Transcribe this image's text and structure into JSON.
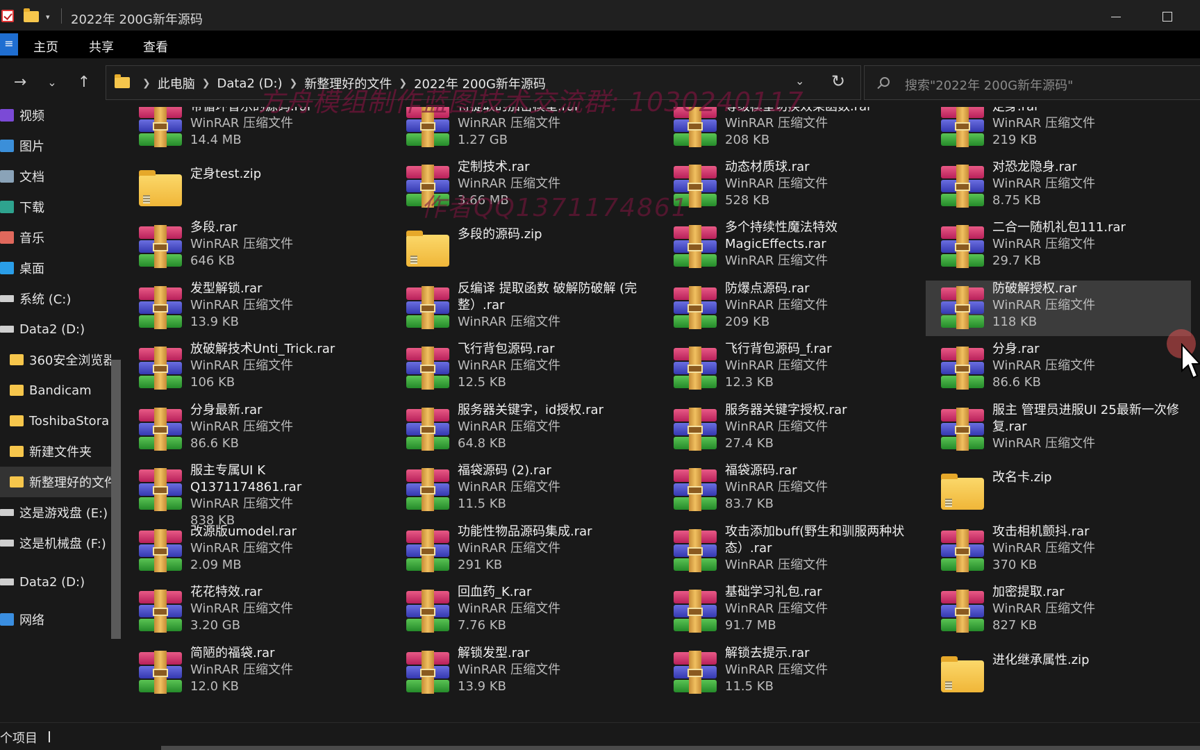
{
  "window": {
    "title": "2022年 200G新年源码",
    "title_dropdown": "▾"
  },
  "ribbon": {
    "file_label": "≡",
    "tabs": [
      "主页",
      "共享",
      "查看"
    ]
  },
  "address": {
    "breadcrumbs": [
      "此电脑",
      "Data2 (D:)",
      "新整理好的文件",
      "2022年 200G新年源码"
    ],
    "search_placeholder": "搜索\"2022年 200G新年源码\""
  },
  "sidebar": {
    "items": [
      {
        "label": "视频",
        "icon": "video-icon"
      },
      {
        "label": "图片",
        "icon": "picture-icon"
      },
      {
        "label": "文档",
        "icon": "document-icon"
      },
      {
        "label": "下载",
        "icon": "download-icon"
      },
      {
        "label": "音乐",
        "icon": "music-icon"
      },
      {
        "label": "桌面",
        "icon": "desktop-icon"
      },
      {
        "label": "系统 (C:)",
        "icon": "drive-icon"
      },
      {
        "label": "Data2 (D:)",
        "icon": "drive-icon"
      },
      {
        "label": "360安全浏览器",
        "icon": "folder-icon"
      },
      {
        "label": "Bandicam",
        "icon": "folder-icon"
      },
      {
        "label": "ToshibaStora",
        "icon": "folder-icon"
      },
      {
        "label": "新建文件夹",
        "icon": "folder-icon"
      },
      {
        "label": "新整理好的文件",
        "icon": "folder-icon"
      },
      {
        "label": "这是游戏盘 (E:)",
        "icon": "drive-icon"
      },
      {
        "label": "这是机械盘 (F:)",
        "icon": "drive-icon"
      },
      {
        "label": "Data2 (D:)",
        "icon": "drive-icon"
      },
      {
        "label": "网络",
        "icon": "network-icon"
      }
    ]
  },
  "files": [
    {
      "name": "带循环音乐的源码.rar",
      "type": "WinRAR 压缩文件",
      "size": "14.4 MB",
      "kind": "rar"
    },
    {
      "name": "待提取的加密模型.rar",
      "type": "WinRAR 压缩文件",
      "size": "1.27 GB",
      "kind": "rar"
    },
    {
      "name": "等级模型切换效果函数.rar",
      "type": "WinRAR 压缩文件",
      "size": "208 KB",
      "kind": "rar"
    },
    {
      "name": "定身.rar",
      "type": "WinRAR 压缩文件",
      "size": "219 KB",
      "kind": "rar"
    },
    {
      "name": "定身test.zip",
      "type": "",
      "size": "",
      "kind": "zip"
    },
    {
      "name": "定制技术.rar",
      "type": "WinRAR 压缩文件",
      "size": "3.66 MB",
      "kind": "rar"
    },
    {
      "name": "动态材质球.rar",
      "type": "WinRAR 压缩文件",
      "size": "528 KB",
      "kind": "rar"
    },
    {
      "name": "对恐龙隐身.rar",
      "type": "WinRAR 压缩文件",
      "size": "8.75 KB",
      "kind": "rar"
    },
    {
      "name": "多段.rar",
      "type": "WinRAR 压缩文件",
      "size": "646 KB",
      "kind": "rar"
    },
    {
      "name": "多段的源码.zip",
      "type": "",
      "size": "",
      "kind": "zip"
    },
    {
      "name": "多个持续性魔法特效 MagicEffects.rar",
      "type": "WinRAR 压缩文件",
      "size": "",
      "kind": "rar"
    },
    {
      "name": "二合一随机礼包111.rar",
      "type": "WinRAR 压缩文件",
      "size": "29.7 KB",
      "kind": "rar"
    },
    {
      "name": "发型解锁.rar",
      "type": "WinRAR 压缩文件",
      "size": "13.9 KB",
      "kind": "rar"
    },
    {
      "name": "反编译 提取函数 破解防破解 (完整）.rar",
      "type": "WinRAR 压缩文件",
      "size": "",
      "kind": "rar"
    },
    {
      "name": "防爆点源码.rar",
      "type": "WinRAR 压缩文件",
      "size": "209 KB",
      "kind": "rar"
    },
    {
      "name": "防破解授权.rar",
      "type": "WinRAR 压缩文件",
      "size": "118 KB",
      "kind": "rar"
    },
    {
      "name": "放破解技术Unti_Trick.rar",
      "type": "WinRAR 压缩文件",
      "size": "106 KB",
      "kind": "rar"
    },
    {
      "name": "飞行背包源码.rar",
      "type": "WinRAR 压缩文件",
      "size": "12.5 KB",
      "kind": "rar"
    },
    {
      "name": "飞行背包源码_f.rar",
      "type": "WinRAR 压缩文件",
      "size": "12.3 KB",
      "kind": "rar"
    },
    {
      "name": "分身.rar",
      "type": "WinRAR 压缩文件",
      "size": "86.6 KB",
      "kind": "rar"
    },
    {
      "name": "分身最新.rar",
      "type": "WinRAR 压缩文件",
      "size": "86.6 KB",
      "kind": "rar"
    },
    {
      "name": "服务器关键字，id授权.rar",
      "type": "WinRAR 压缩文件",
      "size": "64.8 KB",
      "kind": "rar"
    },
    {
      "name": "服务器关键字授权.rar",
      "type": "WinRAR 压缩文件",
      "size": "27.4 KB",
      "kind": "rar"
    },
    {
      "name": "服主 管理员进服UI 25最新一次修复.rar",
      "type": "WinRAR 压缩文件",
      "size": "",
      "kind": "rar"
    },
    {
      "name": "服主专属UI K　Q1371174861.rar",
      "type": "WinRAR 压缩文件",
      "size": "838 KB",
      "kind": "rar"
    },
    {
      "name": "福袋源码 (2).rar",
      "type": "WinRAR 压缩文件",
      "size": "11.5 KB",
      "kind": "rar"
    },
    {
      "name": "福袋源码.rar",
      "type": "WinRAR 压缩文件",
      "size": "83.7 KB",
      "kind": "rar"
    },
    {
      "name": "改名卡.zip",
      "type": "",
      "size": "",
      "kind": "zip"
    },
    {
      "name": "改源版umodel.rar",
      "type": "WinRAR 压缩文件",
      "size": "2.09 MB",
      "kind": "rar"
    },
    {
      "name": "功能性物品源码集成.rar",
      "type": "WinRAR 压缩文件",
      "size": "291 KB",
      "kind": "rar"
    },
    {
      "name": "攻击添加buff(野生和驯服两种状态）.rar",
      "type": "WinRAR 压缩文件",
      "size": "",
      "kind": "rar"
    },
    {
      "name": "攻击相机颤抖.rar",
      "type": "WinRAR 压缩文件",
      "size": "370 KB",
      "kind": "rar"
    },
    {
      "name": "花花特效.rar",
      "type": "WinRAR 压缩文件",
      "size": "3.20 GB",
      "kind": "rar"
    },
    {
      "name": "回血药_K.rar",
      "type": "WinRAR 压缩文件",
      "size": "7.76 KB",
      "kind": "rar"
    },
    {
      "name": "基础学习礼包.rar",
      "type": "WinRAR 压缩文件",
      "size": "91.7 MB",
      "kind": "rar"
    },
    {
      "name": "加密提取.rar",
      "type": "WinRAR 压缩文件",
      "size": "827 KB",
      "kind": "rar"
    },
    {
      "name": "简陋的福袋.rar",
      "type": "WinRAR 压缩文件",
      "size": "12.0 KB",
      "kind": "rar"
    },
    {
      "name": "解锁发型.rar",
      "type": "WinRAR 压缩文件",
      "size": "13.9 KB",
      "kind": "rar"
    },
    {
      "name": "解锁去提示.rar",
      "type": "WinRAR 压缩文件",
      "size": "11.5 KB",
      "kind": "rar"
    },
    {
      "name": "进化继承属性.zip",
      "type": "",
      "size": "",
      "kind": "zip"
    }
  ],
  "watermarks": {
    "line1": "方舟模组制作蓝图技术交流群: 1030240117",
    "line2": "作者QQ1371174861"
  },
  "status": {
    "text": "个项目"
  }
}
